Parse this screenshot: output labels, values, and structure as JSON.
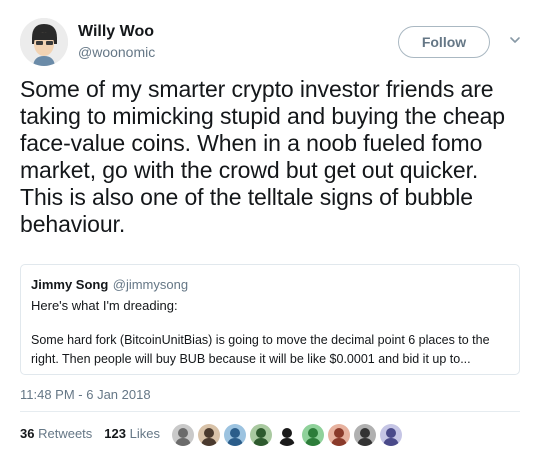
{
  "author": {
    "display_name": "Willy Woo",
    "handle": "@woonomic"
  },
  "follow_label": "Follow",
  "tweet_text": "Some of my smarter crypto investor friends are taking to mimicking stupid and buying the cheap face-value coins. When in a noob fueled fomo market, go with the crowd but get out quicker. This is also one of the telltale signs of bubble behaviour.",
  "quoted": {
    "display_name": "Jimmy Song",
    "handle": "@jimmysong",
    "line1": "Here's what I'm dreading:",
    "line2": "Some hard fork (BitcoinUnitBias) is going to move the decimal point 6 places to the right. Then people will buy BUB because it will be like $0.0001 and bid it up to..."
  },
  "timestamp": "11:48 PM - 6 Jan 2018",
  "stats": {
    "retweets_count": "36",
    "retweets_label": "Retweets",
    "likes_count": "123",
    "likes_label": "Likes"
  },
  "likers": [
    {
      "color": "#6b6b6b",
      "bg": "#c9c9c9"
    },
    {
      "color": "#4a3a2e",
      "bg": "#d8c2a8"
    },
    {
      "color": "#2b5d8a",
      "bg": "#9cc3e0"
    },
    {
      "color": "#2e5a2e",
      "bg": "#a9c9a0"
    },
    {
      "color": "#1a1a1a",
      "bg": "#ffffff"
    },
    {
      "color": "#2d7d3a",
      "bg": "#8fd19a"
    },
    {
      "color": "#8a3a2a",
      "bg": "#e7b29f"
    },
    {
      "color": "#333333",
      "bg": "#b0b0b0"
    },
    {
      "color": "#4a4a8a",
      "bg": "#c5c5e5"
    }
  ]
}
